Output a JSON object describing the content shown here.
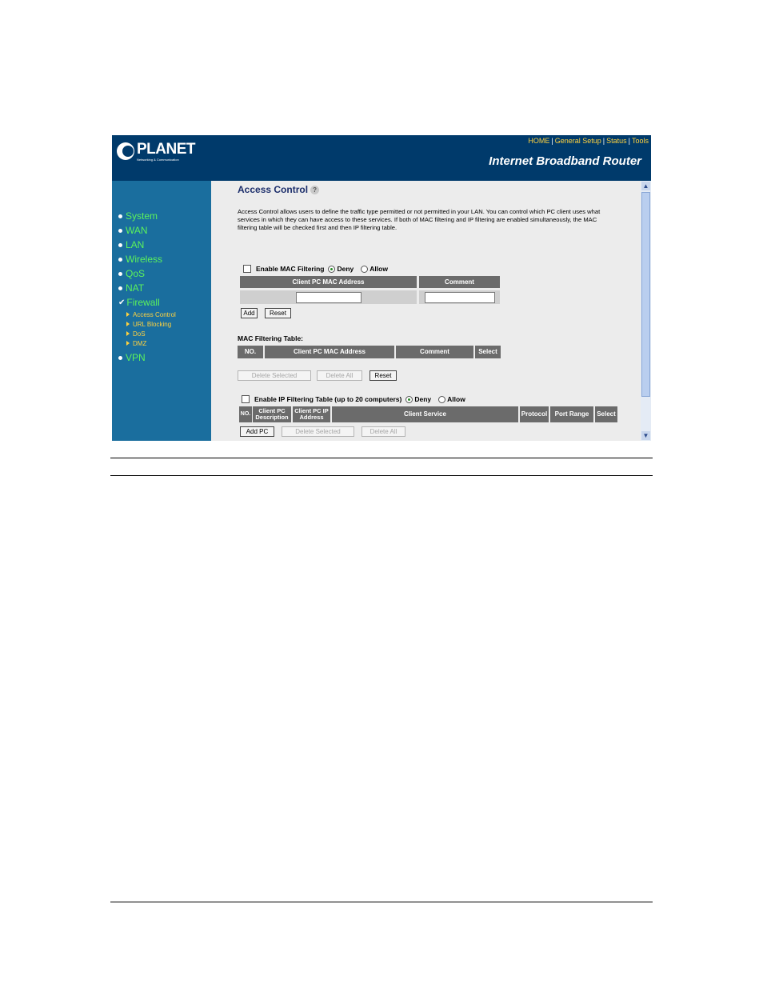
{
  "header": {
    "brand": "PLANET",
    "brand_tagline": "Networking & Communication",
    "links": [
      "HOME",
      "General Setup",
      "Status",
      "Tools"
    ],
    "product_title": "Internet Broadband Router"
  },
  "sidebar": {
    "items": [
      {
        "label": "System",
        "icon": "bullet"
      },
      {
        "label": "WAN",
        "icon": "bullet"
      },
      {
        "label": "LAN",
        "icon": "bullet"
      },
      {
        "label": "Wireless",
        "icon": "bullet"
      },
      {
        "label": "QoS",
        "icon": "bullet"
      },
      {
        "label": "NAT",
        "icon": "bullet"
      },
      {
        "label": "Firewall",
        "icon": "check"
      },
      {
        "label": "VPN",
        "icon": "bullet"
      }
    ],
    "firewall_subitems": [
      "Access Control",
      "URL Blocking",
      "DoS",
      "DMZ"
    ]
  },
  "main": {
    "title": "Access Control",
    "description": "Access Control allows users to define the traffic type permitted or not permitted in your LAN. You can control which PC client uses what services in which they can have access to these services. If both of MAC filtering and IP filtering are enabled simultaneously, the MAC filtering table will be checked first and then IP filtering table.",
    "mac_filter": {
      "enable_label": "Enable MAC Filtering",
      "deny_label": "Deny",
      "allow_label": "Allow",
      "selected": "Deny",
      "col_mac": "Client PC MAC Address",
      "col_comment": "Comment",
      "mac_value": "",
      "comment_value": "",
      "add_label": "Add",
      "reset_label": "Reset"
    },
    "mac_table": {
      "title": "MAC Filtering Table:",
      "columns": [
        "NO.",
        "Client PC MAC Address",
        "Comment",
        "Select"
      ],
      "delete_selected_label": "Delete Selected",
      "delete_all_label": "Delete All",
      "reset_label": "Reset"
    },
    "ip_filter": {
      "enable_label": "Enable IP Filtering Table (up to 20 computers)",
      "deny_label": "Deny",
      "allow_label": "Allow",
      "selected": "Deny",
      "columns": [
        "NO.",
        "Client PC Description",
        "Client PC IP Address",
        "Client Service",
        "Protocol",
        "Port Range",
        "Select"
      ],
      "add_pc_label": "Add PC",
      "delete_selected_label": "Delete Selected",
      "delete_all_label": "Delete All"
    }
  }
}
